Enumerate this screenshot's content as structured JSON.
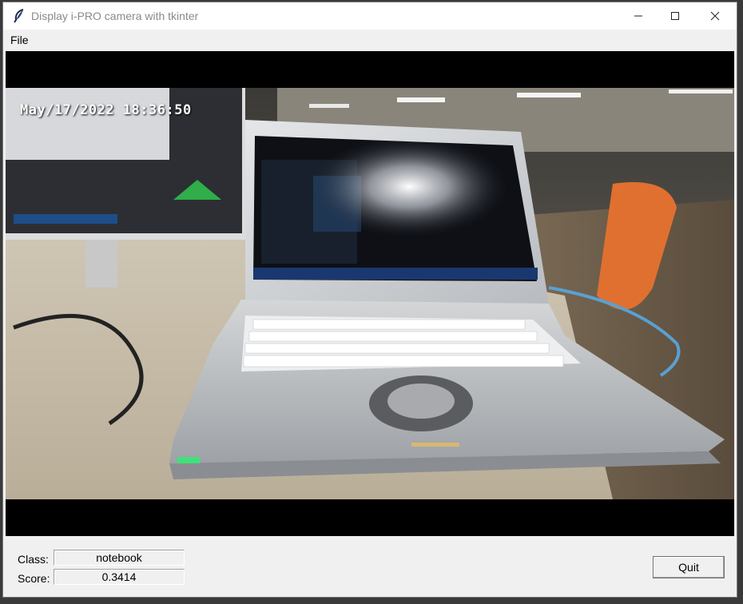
{
  "window": {
    "title": "Display i-PRO camera with tkinter"
  },
  "menu": {
    "file_label": "File"
  },
  "video": {
    "timestamp": "May/17/2022 18:36:50"
  },
  "results": {
    "class_label": "Class:",
    "class_value": "notebook",
    "score_label": "Score:",
    "score_value": "0.3414"
  },
  "buttons": {
    "quit_label": "Quit"
  },
  "icons": {
    "app": "feather-icon",
    "minimize": "minimize-icon",
    "maximize": "maximize-icon",
    "close": "close-icon"
  }
}
